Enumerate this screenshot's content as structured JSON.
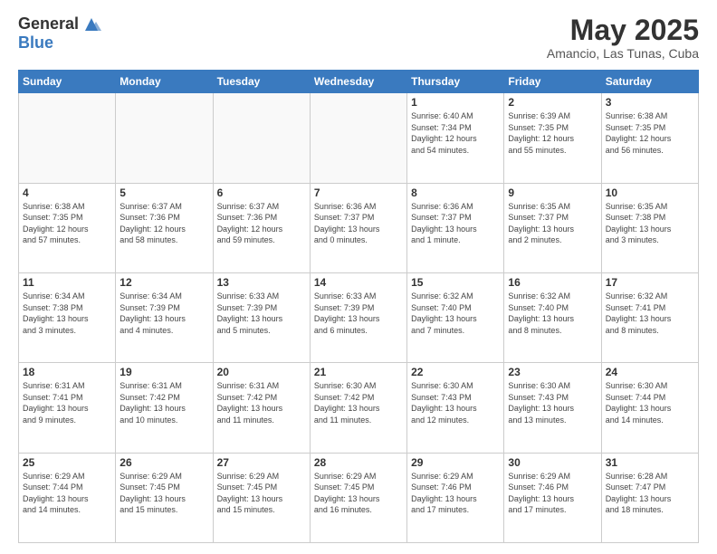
{
  "header": {
    "logo_general": "General",
    "logo_blue": "Blue",
    "title": "May 2025",
    "location": "Amancio, Las Tunas, Cuba"
  },
  "days_of_week": [
    "Sunday",
    "Monday",
    "Tuesday",
    "Wednesday",
    "Thursday",
    "Friday",
    "Saturday"
  ],
  "weeks": [
    [
      {
        "day": "",
        "info": ""
      },
      {
        "day": "",
        "info": ""
      },
      {
        "day": "",
        "info": ""
      },
      {
        "day": "",
        "info": ""
      },
      {
        "day": "1",
        "info": "Sunrise: 6:40 AM\nSunset: 7:34 PM\nDaylight: 12 hours\nand 54 minutes."
      },
      {
        "day": "2",
        "info": "Sunrise: 6:39 AM\nSunset: 7:35 PM\nDaylight: 12 hours\nand 55 minutes."
      },
      {
        "day": "3",
        "info": "Sunrise: 6:38 AM\nSunset: 7:35 PM\nDaylight: 12 hours\nand 56 minutes."
      }
    ],
    [
      {
        "day": "4",
        "info": "Sunrise: 6:38 AM\nSunset: 7:35 PM\nDaylight: 12 hours\nand 57 minutes."
      },
      {
        "day": "5",
        "info": "Sunrise: 6:37 AM\nSunset: 7:36 PM\nDaylight: 12 hours\nand 58 minutes."
      },
      {
        "day": "6",
        "info": "Sunrise: 6:37 AM\nSunset: 7:36 PM\nDaylight: 12 hours\nand 59 minutes."
      },
      {
        "day": "7",
        "info": "Sunrise: 6:36 AM\nSunset: 7:37 PM\nDaylight: 13 hours\nand 0 minutes."
      },
      {
        "day": "8",
        "info": "Sunrise: 6:36 AM\nSunset: 7:37 PM\nDaylight: 13 hours\nand 1 minute."
      },
      {
        "day": "9",
        "info": "Sunrise: 6:35 AM\nSunset: 7:37 PM\nDaylight: 13 hours\nand 2 minutes."
      },
      {
        "day": "10",
        "info": "Sunrise: 6:35 AM\nSunset: 7:38 PM\nDaylight: 13 hours\nand 3 minutes."
      }
    ],
    [
      {
        "day": "11",
        "info": "Sunrise: 6:34 AM\nSunset: 7:38 PM\nDaylight: 13 hours\nand 3 minutes."
      },
      {
        "day": "12",
        "info": "Sunrise: 6:34 AM\nSunset: 7:39 PM\nDaylight: 13 hours\nand 4 minutes."
      },
      {
        "day": "13",
        "info": "Sunrise: 6:33 AM\nSunset: 7:39 PM\nDaylight: 13 hours\nand 5 minutes."
      },
      {
        "day": "14",
        "info": "Sunrise: 6:33 AM\nSunset: 7:39 PM\nDaylight: 13 hours\nand 6 minutes."
      },
      {
        "day": "15",
        "info": "Sunrise: 6:32 AM\nSunset: 7:40 PM\nDaylight: 13 hours\nand 7 minutes."
      },
      {
        "day": "16",
        "info": "Sunrise: 6:32 AM\nSunset: 7:40 PM\nDaylight: 13 hours\nand 8 minutes."
      },
      {
        "day": "17",
        "info": "Sunrise: 6:32 AM\nSunset: 7:41 PM\nDaylight: 13 hours\nand 8 minutes."
      }
    ],
    [
      {
        "day": "18",
        "info": "Sunrise: 6:31 AM\nSunset: 7:41 PM\nDaylight: 13 hours\nand 9 minutes."
      },
      {
        "day": "19",
        "info": "Sunrise: 6:31 AM\nSunset: 7:42 PM\nDaylight: 13 hours\nand 10 minutes."
      },
      {
        "day": "20",
        "info": "Sunrise: 6:31 AM\nSunset: 7:42 PM\nDaylight: 13 hours\nand 11 minutes."
      },
      {
        "day": "21",
        "info": "Sunrise: 6:30 AM\nSunset: 7:42 PM\nDaylight: 13 hours\nand 11 minutes."
      },
      {
        "day": "22",
        "info": "Sunrise: 6:30 AM\nSunset: 7:43 PM\nDaylight: 13 hours\nand 12 minutes."
      },
      {
        "day": "23",
        "info": "Sunrise: 6:30 AM\nSunset: 7:43 PM\nDaylight: 13 hours\nand 13 minutes."
      },
      {
        "day": "24",
        "info": "Sunrise: 6:30 AM\nSunset: 7:44 PM\nDaylight: 13 hours\nand 14 minutes."
      }
    ],
    [
      {
        "day": "25",
        "info": "Sunrise: 6:29 AM\nSunset: 7:44 PM\nDaylight: 13 hours\nand 14 minutes."
      },
      {
        "day": "26",
        "info": "Sunrise: 6:29 AM\nSunset: 7:45 PM\nDaylight: 13 hours\nand 15 minutes."
      },
      {
        "day": "27",
        "info": "Sunrise: 6:29 AM\nSunset: 7:45 PM\nDaylight: 13 hours\nand 15 minutes."
      },
      {
        "day": "28",
        "info": "Sunrise: 6:29 AM\nSunset: 7:45 PM\nDaylight: 13 hours\nand 16 minutes."
      },
      {
        "day": "29",
        "info": "Sunrise: 6:29 AM\nSunset: 7:46 PM\nDaylight: 13 hours\nand 17 minutes."
      },
      {
        "day": "30",
        "info": "Sunrise: 6:29 AM\nSunset: 7:46 PM\nDaylight: 13 hours\nand 17 minutes."
      },
      {
        "day": "31",
        "info": "Sunrise: 6:28 AM\nSunset: 7:47 PM\nDaylight: 13 hours\nand 18 minutes."
      }
    ]
  ]
}
